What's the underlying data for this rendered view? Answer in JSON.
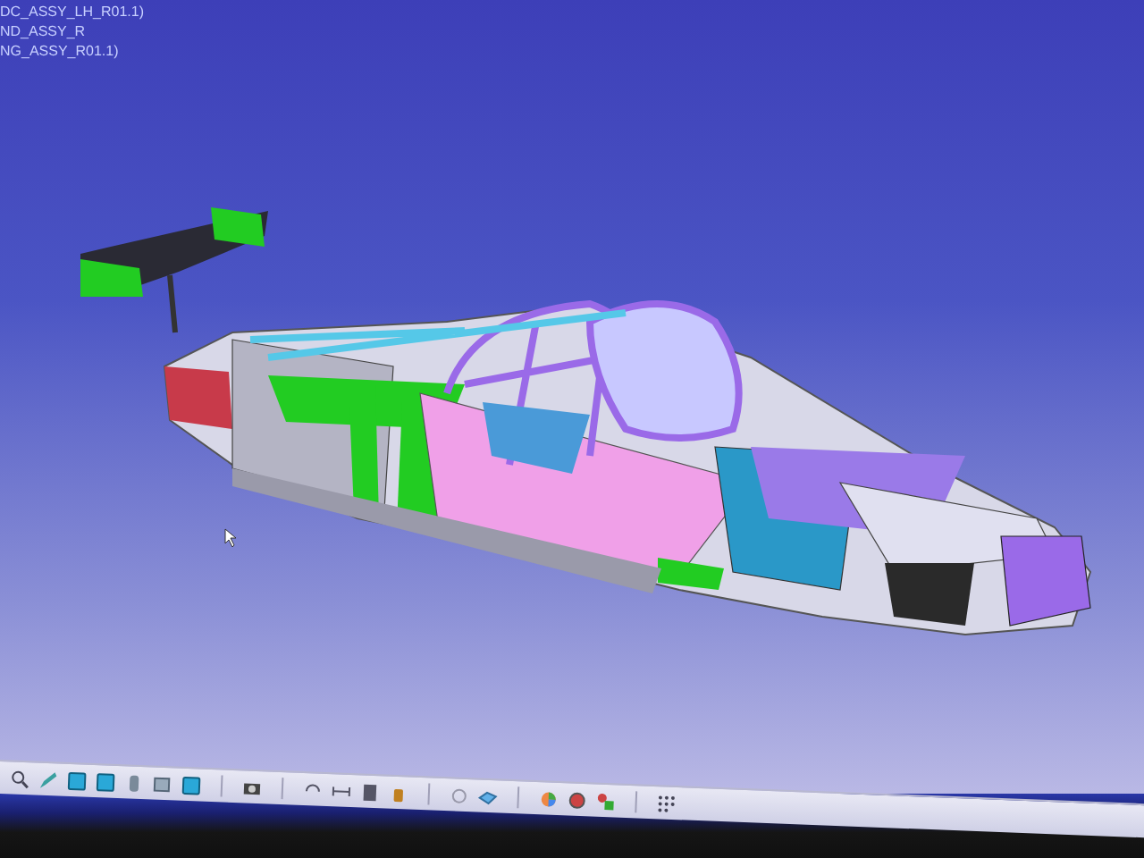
{
  "spec_tree": {
    "items": [
      {
        "label": "DC_ASSY_LH_R01.1)"
      },
      {
        "label": "ND_ASSY_R"
      },
      {
        "label": "NG_ASSY_R01.1)"
      }
    ]
  }
}
